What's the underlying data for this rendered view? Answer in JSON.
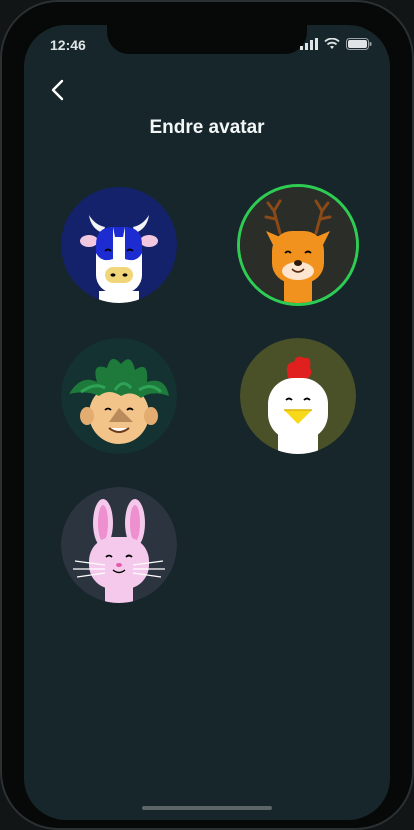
{
  "status": {
    "time": "12:46"
  },
  "header": {
    "title": "Endre avatar"
  },
  "avatars": [
    {
      "id": "cow",
      "bg": "#13226b",
      "selected": false
    },
    {
      "id": "deer",
      "bg": "#2a2d28",
      "selected": true
    },
    {
      "id": "troll",
      "bg": "#133231",
      "selected": false
    },
    {
      "id": "chicken",
      "bg": "#4a5128",
      "selected": false
    },
    {
      "id": "bunny",
      "bg": "#2c3440",
      "selected": false
    }
  ],
  "colors": {
    "selected_ring": "#2ecc53",
    "background": "#17262a"
  }
}
